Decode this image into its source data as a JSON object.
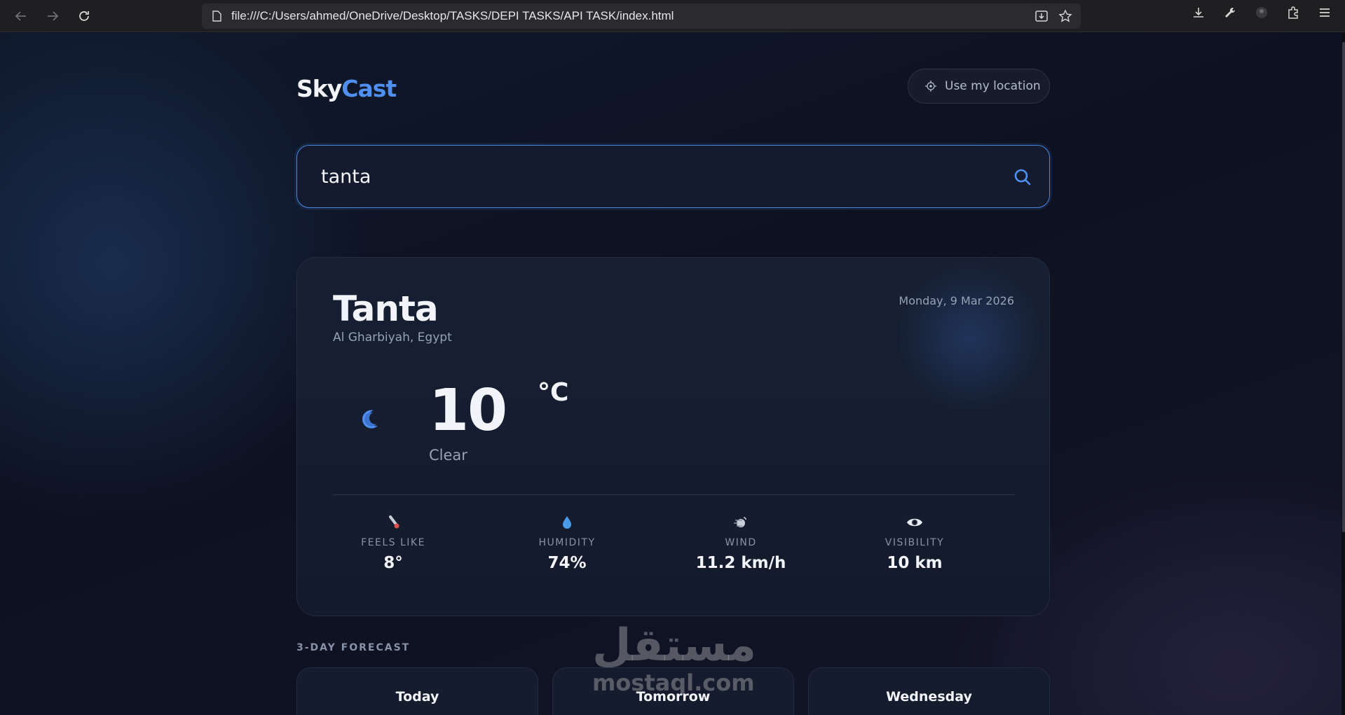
{
  "browser": {
    "url": "file:///C:/Users/ahmed/OneDrive/Desktop/TASKS/DEPI TASKS/API TASK/index.html"
  },
  "header": {
    "logo_part1": "Sky",
    "logo_part2": "Cast",
    "location_button": "Use my location"
  },
  "search": {
    "value": "tanta",
    "placeholder": ""
  },
  "current": {
    "city": "Tanta",
    "region": "Al Gharbiyah, Egypt",
    "date": "Monday, 9 Mar 2026",
    "temp": "10",
    "unit": "°C",
    "condition": "Clear",
    "condition_icon": "moon-icon"
  },
  "stats": [
    {
      "label": "FEELS LIKE",
      "value": "8°",
      "icon": "thermometer-icon"
    },
    {
      "label": "HUMIDITY",
      "value": "74%",
      "icon": "droplet-icon"
    },
    {
      "label": "WIND",
      "value": "11.2 km/h",
      "icon": "wind-icon"
    },
    {
      "label": "VISIBILITY",
      "value": "10 km",
      "icon": "eye-icon"
    }
  ],
  "forecast": {
    "title": "3-DAY FORECAST",
    "days": [
      {
        "day": "Today"
      },
      {
        "day": "Tomorrow"
      },
      {
        "day": "Wednesday"
      }
    ]
  },
  "watermark": {
    "arabic": "مستقل",
    "latin": "mostaql.com"
  },
  "colors": {
    "accent": "#4f8ff0",
    "background": "#0f1320",
    "card": "#172033"
  }
}
